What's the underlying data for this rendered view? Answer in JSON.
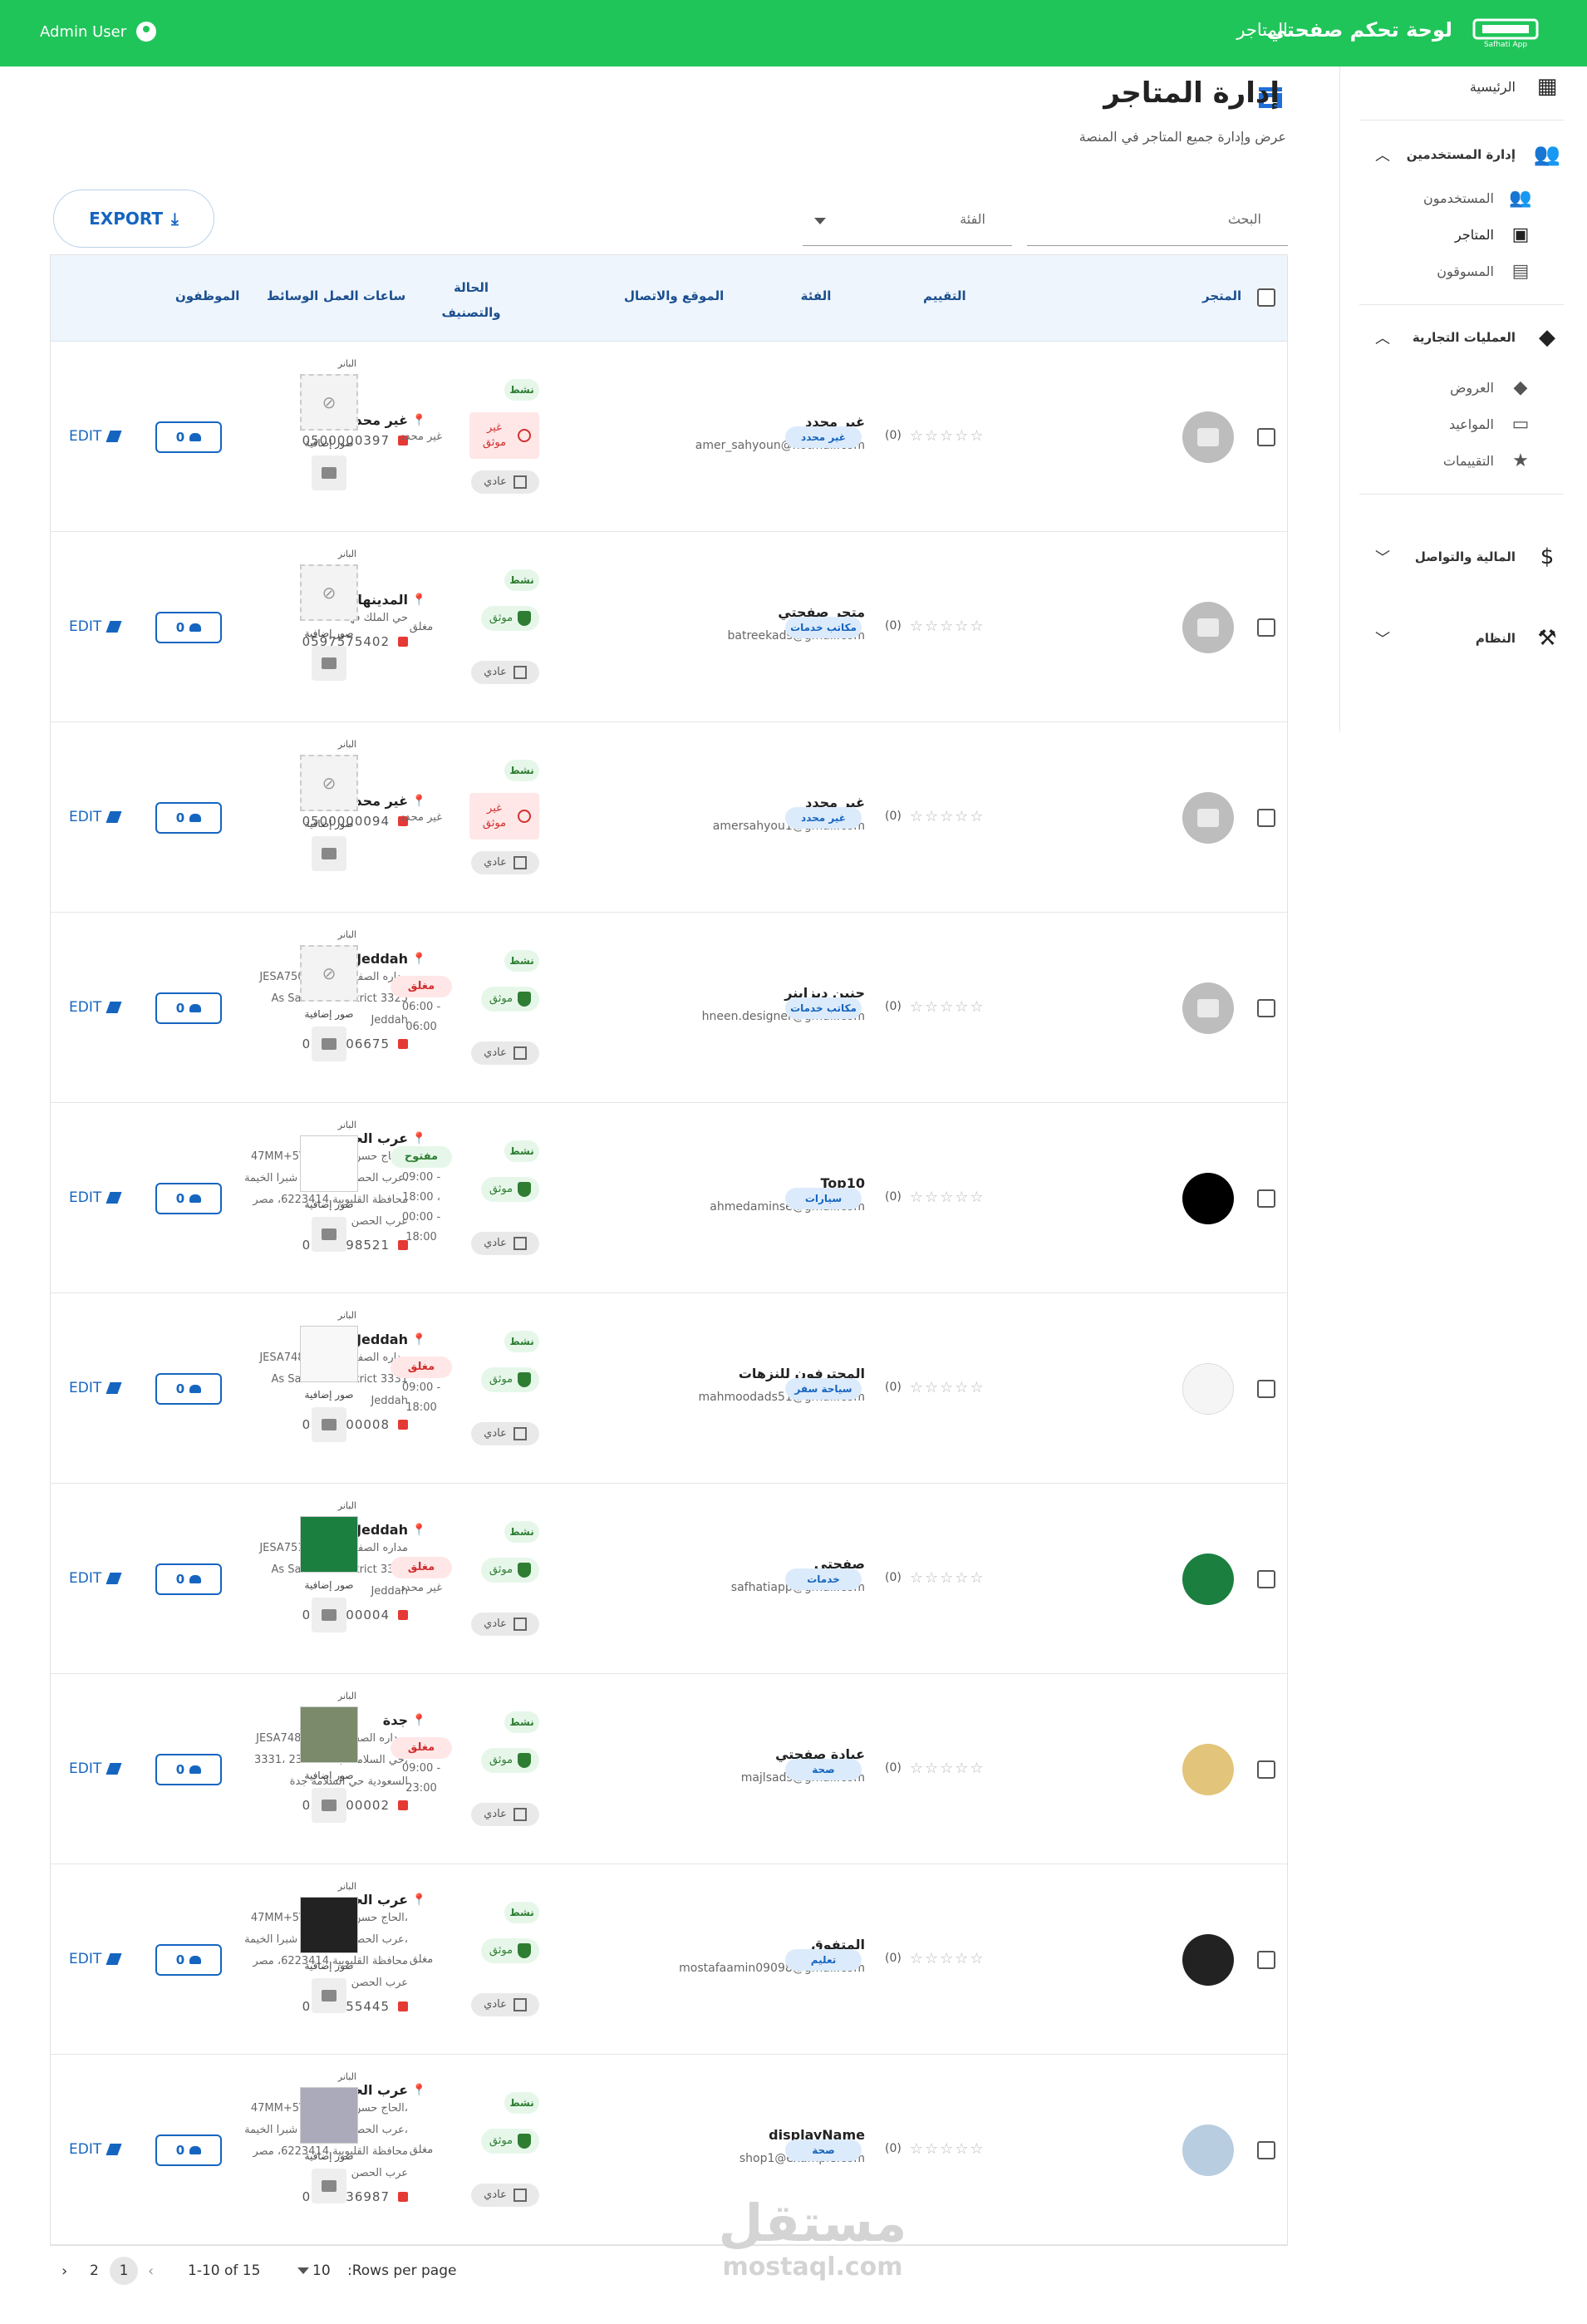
{
  "topbar": {
    "user": "Admin User",
    "brand": "لوحة تحكم صفحتي",
    "nav_stores": "المتاجر",
    "logo_text": "Safhati App"
  },
  "sidebar": {
    "home": "الرئيسية",
    "users_group": "إدارة المستخدمين",
    "users": "المستخدمون",
    "stores": "المتاجر",
    "marketers": "المسوقون",
    "business_group": "العمليات التجارية",
    "offers": "العروض",
    "appointments": "المواعيد",
    "ratings": "التقييمات",
    "finance_group": "المالية والتواصل",
    "system_group": "النظام"
  },
  "page": {
    "title": "إدارة المتاجر",
    "subtitle": "عرض وإدارة جميع المتاجر في المنصة"
  },
  "toolbar": {
    "export_label": "EXPORT",
    "search_label": "البحث",
    "category_label": "الفئة"
  },
  "table": {
    "headers": {
      "store": "المتجر",
      "rating": "التقييم",
      "category": "الفئة",
      "location": "الموقع والاتصال",
      "status": "الحالة والتصنيف",
      "hours": "ساعات العمل",
      "media": "الوسائط",
      "staff": "الموظفون"
    },
    "labels": {
      "active": "نشط",
      "verified": "موثق",
      "unverified": "غير موثق",
      "normal": "عادي",
      "banner": "البانر",
      "extra_images": "صور إضافية",
      "edit": "EDIT"
    },
    "rows": [
      {
        "name": "غير محدد",
        "email": "amer_sahyoun@hotmail.com",
        "rating": "(0)",
        "category": "غير محدد",
        "loc_name": "غير محدد",
        "address": [],
        "phone": "0500000397",
        "verified": false,
        "hours_chip": "",
        "hours_text": [
          "غير محدد"
        ],
        "staff": "0",
        "avatar": "gray"
      },
      {
        "name": "متجر صفحتي",
        "email": "batreekads@gmail.com",
        "rating": "(0)",
        "category": "مكاتب خدمات",
        "loc_name": "المدينهالمنوره",
        "address": [
          "حي الملك فهد"
        ],
        "phone": "0597575402",
        "verified": true,
        "hours_chip": "",
        "hours_text": [
          "مغلق"
        ],
        "staff": "0",
        "avatar": "gray"
      },
      {
        "name": "غير محدد",
        "email": "amersahyou1@gmail.com",
        "rating": "(0)",
        "category": "غير محدد",
        "loc_name": "غير محدد",
        "address": [],
        "phone": "0500000094",
        "verified": false,
        "hours_chip": "",
        "hours_text": [
          "غير محدد"
        ],
        "staff": "0",
        "avatar": "gray"
      },
      {
        "name": "حنين ديزاينر",
        "email": "hneen.designer@gmail.com",
        "rating": "(0)",
        "category": "مكاتب خدمات",
        "loc_name": "Jeddah",
        "address": [
          "JESA7502- 7502 مداره الصفاء",
          "As Salamah District 3325",
          "Jeddah"
        ],
        "phone": "0570806675",
        "verified": true,
        "hours_chip": "مغلق",
        "hours_open": false,
        "hours_text": [
          "06:00 -",
          "06:00"
        ],
        "staff": "0",
        "avatar": "gray"
      },
      {
        "name": "Top10",
        "email": "ahmedaminse@gmail.com",
        "rating": "(0)",
        "category": "سيارات",
        "loc_name": "عرب الحصن",
        "address": [
          "47MM+5V4- الحاج حسن يوسف،",
          "عرب الحصن، قسم ثان شبرا الخيمة،",
          "محافظة القليوبية 6223414، مصر",
          "عرب الحصن"
        ],
        "phone": "0503698521",
        "verified": true,
        "hours_chip": "مفتوح",
        "hours_open": true,
        "hours_text": [
          "09:00 -",
          "18:00 ،",
          "00:00 -",
          "18:00"
        ],
        "staff": "0",
        "avatar": "black"
      },
      {
        "name": "المحترفون للنزهات",
        "email": "mahmoodads51@gmail.com",
        "rating": "(0)",
        "category": "سياحة سفر",
        "loc_name": "Jeddah",
        "address": [
          "JESA7488- 7488 مداره الصفاء",
          "As Salamah District 3331",
          "Jeddah"
        ],
        "phone": "0560000008",
        "verified": true,
        "hours_chip": "مغلق",
        "hours_open": false,
        "hours_text": [
          "09:00 -",
          "18:00"
        ],
        "staff": "0",
        "avatar": "white"
      },
      {
        "name": "صفحتي",
        "email": "safhatiapp@gmail.com",
        "rating": "(0)",
        "category": "خدمات",
        "loc_name": "Jeddah",
        "address": [
          "JESA7513- 7513 مداره الصفاء",
          "As Salamah District 3361",
          "Jeddah"
        ],
        "phone": "0500000004",
        "verified": true,
        "hours_chip": "مغلق",
        "hours_open": false,
        "hours_text": [
          "غير محدد"
        ],
        "staff": "0",
        "avatar": "green"
      },
      {
        "name": "عيادة صفحتي",
        "email": "majlsads@gmail.com",
        "rating": "(0)",
        "category": "صحة",
        "loc_name": "جدة",
        "address": [
          "JESA7488- 7488 مداره الصفاء،",
          "3331، حي السلامة، جدة 23436،",
          "السعودية حي السلامة جدة"
        ],
        "phone": "0500000002",
        "verified": true,
        "hours_chip": "مغلق",
        "hours_open": false,
        "hours_text": [
          "09:00 -",
          "23:00"
        ],
        "staff": "0",
        "avatar": "gold"
      },
      {
        "name": "المتفوق",
        "email": "mostafaamin09098@gmail.com",
        "rating": "(0)",
        "category": "تعليم",
        "loc_name": "عرب الحصن",
        "address": [
          "47MM+5V4- الحاج حسن يوسف،",
          "عرب الحصن، قسم ثان شبرا الخيمة،",
          "محافظة القليوبية 6223414، مصر",
          "عرب الحصن"
        ],
        "phone": "0554355445",
        "verified": true,
        "hours_chip": "",
        "hours_text": [
          "مغلق"
        ],
        "staff": "0",
        "avatar": "dark"
      },
      {
        "name": "displayName",
        "email": "shop1@example.com",
        "rating": "(0)",
        "category": "صحة",
        "loc_name": "عرب الحصن",
        "address": [
          "47MM+5V4- الحاج حسن يوسف،",
          "عرب الحصن، قسم ثان شبرا الخيمة،",
          "محافظة القليوبية 6223414، مصر",
          "عرب الحصن"
        ],
        "phone": "0501236987",
        "verified": true,
        "hours_chip": "",
        "hours_text": [
          "مغلق"
        ],
        "staff": "0",
        "avatar": "sky"
      }
    ]
  },
  "pagination": {
    "rows_label": ":Rows per page",
    "rows_value": "10",
    "range": "1-10 of 15",
    "page_1": "1",
    "page_2": "2"
  },
  "watermark": {
    "line1": "مستقل",
    "line2": "mostaql.com"
  }
}
